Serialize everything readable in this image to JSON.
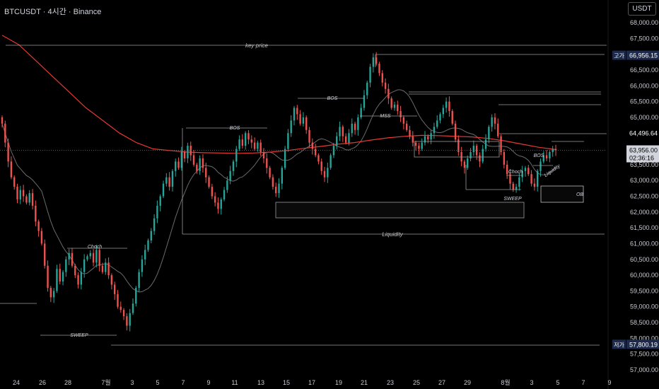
{
  "title": "BTCUSDT · 4시간 · Binance",
  "unit_button": "USDT",
  "price_tags": {
    "high": {
      "label": "고가",
      "value": "66,956.15"
    },
    "low": {
      "label": "저가",
      "value": "57,800.19"
    },
    "level": {
      "value": "64,496.64"
    },
    "current": {
      "value": "63,956.00",
      "countdown": "02:36:16"
    }
  },
  "annotations": {
    "key_price": "key price",
    "bos": "BOS",
    "mss": "MSS",
    "choch": "Choch",
    "sweep": "SWEEP",
    "liquidity": "Liquidity",
    "ob": "OB"
  },
  "colors": {
    "bull": "#26a69a",
    "bear": "#ef5350",
    "ma_red": "#e53935",
    "ma_gray": "#6b6b6b",
    "high_tag": "#1e2a4a",
    "current_tag": "#d1d4dc"
  },
  "chart_data": {
    "type": "candlestick",
    "symbol": "BTCUSDT",
    "interval": "4시간",
    "exchange": "Binance",
    "ylim": [
      56700,
      68400
    ],
    "y_ticks": [
      "57,000.00",
      "57,500.00",
      "58,000.00",
      "58,500.00",
      "59,000.00",
      "59,500.00",
      "60,000.00",
      "60,500.00",
      "61,000.00",
      "61,500.00",
      "62,000.00",
      "62,500.00",
      "63,000.00",
      "63,500.00",
      "64,000.00",
      "64,500.00",
      "65,000.00",
      "65,500.00",
      "66,000.00",
      "66,500.00",
      "67,000.00",
      "67,500.00",
      "68,000.00"
    ],
    "x_ticks": [
      "24",
      "26",
      "28",
      "7월",
      "3",
      "5",
      "7",
      "9",
      "11",
      "13",
      "15",
      "17",
      "19",
      "21",
      "23",
      "25",
      "27",
      "29",
      "8월",
      "3",
      "5",
      "7",
      "9"
    ],
    "closes": [
      64800,
      64200,
      63600,
      63100,
      62800,
      62400,
      62700,
      62500,
      62300,
      62600,
      62200,
      61700,
      61400,
      61000,
      60300,
      59600,
      59300,
      59500,
      60200,
      59800,
      60100,
      60500,
      60700,
      60300,
      60000,
      59700,
      60100,
      60500,
      60600,
      60700,
      60400,
      60800,
      60300,
      60100,
      60400,
      60000,
      59700,
      59400,
      59000,
      58900,
      58700,
      58400,
      58800,
      59100,
      59600,
      60100,
      60500,
      60800,
      61100,
      61400,
      61800,
      62200,
      62500,
      62900,
      63100,
      62800,
      63300,
      63600,
      63400,
      63900,
      63700,
      64100,
      63800,
      63500,
      63300,
      63700,
      63400,
      63100,
      62800,
      62500,
      62300,
      62100,
      62400,
      62700,
      63000,
      63300,
      63600,
      64000,
      64300,
      64100,
      64500,
      64300,
      64200,
      64000,
      64200,
      63900,
      63700,
      63400,
      63100,
      62800,
      62600,
      62900,
      63400,
      64000,
      64500,
      64900,
      65300,
      65100,
      64800,
      65000,
      64600,
      64200,
      64000,
      63800,
      63600,
      63300,
      63100,
      63400,
      63800,
      64100,
      64400,
      64700,
      64400,
      64200,
      64500,
      64800,
      64600,
      65000,
      65300,
      65700,
      66100,
      66600,
      66900,
      66700,
      66400,
      66100,
      65900,
      65600,
      65300,
      65400,
      65200,
      65000,
      64800,
      64600,
      64400,
      64200,
      64100,
      64000,
      64200,
      64400,
      64300,
      64500,
      64700,
      64900,
      65100,
      65300,
      65500,
      65200,
      64800,
      64300,
      63900,
      63600,
      63400,
      63700,
      63900,
      64100,
      63800,
      63600,
      64000,
      64300,
      64700,
      65000,
      64800,
      64400,
      63900,
      63500,
      63200,
      62900,
      62700,
      62800,
      63100,
      63300,
      63400,
      63200,
      62900,
      62800,
      63300,
      63600,
      63800,
      63700,
      63900,
      64000,
      63956
    ]
  }
}
